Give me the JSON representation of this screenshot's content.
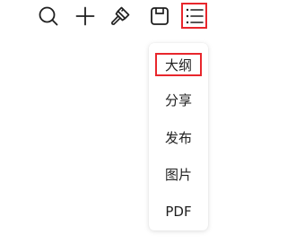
{
  "toolbar": {
    "icons": [
      "search-icon",
      "plus-icon",
      "paint-brush-icon",
      "save-icon",
      "outline-list-icon"
    ],
    "icon_color": "#1f1f1f",
    "highlight_color": "#e8262c"
  },
  "menu": {
    "items": [
      {
        "label": "大纲",
        "highlighted": true
      },
      {
        "label": "分享",
        "highlighted": false
      },
      {
        "label": "发布",
        "highlighted": false
      },
      {
        "label": "图片",
        "highlighted": false
      },
      {
        "label": "PDF",
        "highlighted": false
      }
    ]
  }
}
